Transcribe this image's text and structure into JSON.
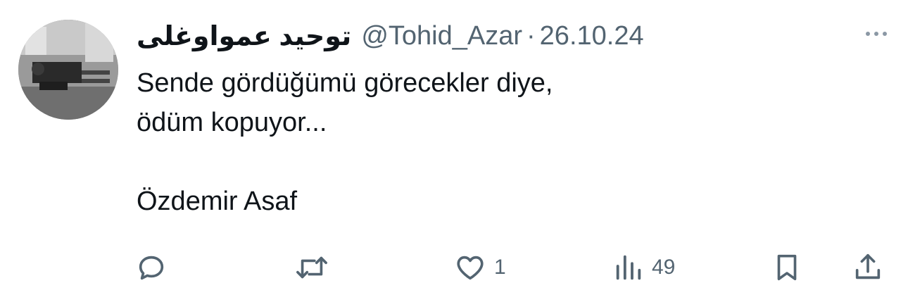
{
  "tweet": {
    "author_name": "توحید عمواوغلی",
    "handle": "@Tohid_Azar",
    "separator": "·",
    "date": "26.10.24",
    "text_lines": [
      "Sende gördüğümü görecekler diye,",
      "ödüm kopuyor...",
      "",
      "Özdemir Asaf"
    ]
  },
  "actions": {
    "replies": "",
    "reposts": "",
    "likes": "1",
    "views": "49"
  },
  "icons": {
    "reply": "reply-icon",
    "repost": "repost-icon",
    "like": "heart-icon",
    "views": "views-icon",
    "bookmark": "bookmark-icon",
    "share": "share-icon",
    "more": "more-icon"
  },
  "colors": {
    "text": "#0f1419",
    "secondary": "#536471"
  }
}
